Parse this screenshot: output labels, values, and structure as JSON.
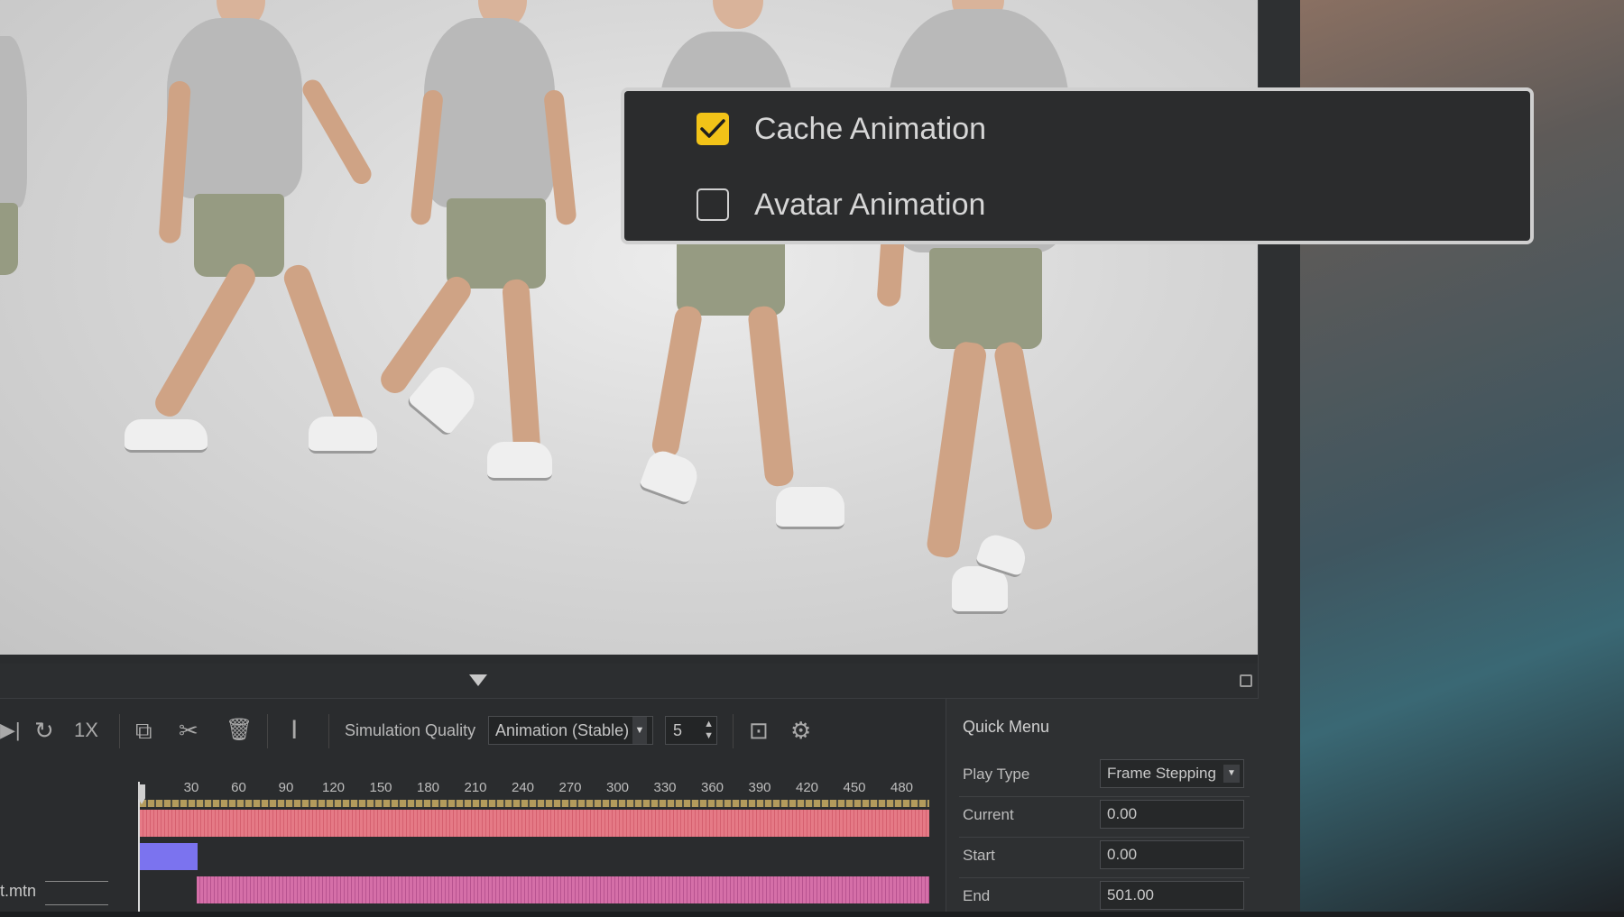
{
  "popup": {
    "options": [
      {
        "label": "Cache Animation",
        "checked": true
      },
      {
        "label": "Avatar Animation",
        "checked": false
      }
    ],
    "check_color": "#f2c318"
  },
  "toolbar": {
    "speed_label": "1X",
    "simulation_quality_label": "Simulation Quality",
    "simulation_quality_value": "Animation (Stable)",
    "stepper_value": "5"
  },
  "timeline": {
    "ruler_ticks": [
      "30",
      "60",
      "90",
      "120",
      "150",
      "180",
      "210",
      "240",
      "270",
      "300",
      "330",
      "360",
      "390",
      "420",
      "450",
      "480"
    ],
    "track_name": "t.mtn"
  },
  "quick_menu": {
    "title": "Quick Menu",
    "rows": [
      {
        "label": "Play Type",
        "value": "Frame Stepping"
      },
      {
        "label": "Current",
        "value": "0.00"
      },
      {
        "label": "Start",
        "value": "0.00"
      },
      {
        "label": "End",
        "value": "501.00"
      }
    ]
  }
}
